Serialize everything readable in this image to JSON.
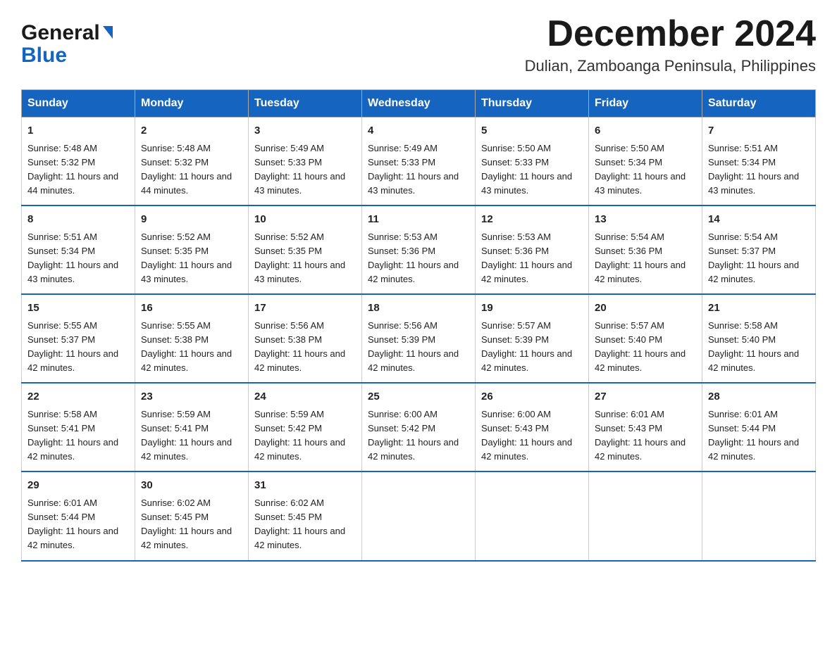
{
  "header": {
    "logo_general": "General",
    "logo_blue": "Blue",
    "month_title": "December 2024",
    "location": "Dulian, Zamboanga Peninsula, Philippines"
  },
  "days_of_week": [
    "Sunday",
    "Monday",
    "Tuesday",
    "Wednesday",
    "Thursday",
    "Friday",
    "Saturday"
  ],
  "weeks": [
    [
      {
        "day": "1",
        "sunrise": "5:48 AM",
        "sunset": "5:32 PM",
        "daylight": "11 hours and 44 minutes."
      },
      {
        "day": "2",
        "sunrise": "5:48 AM",
        "sunset": "5:32 PM",
        "daylight": "11 hours and 44 minutes."
      },
      {
        "day": "3",
        "sunrise": "5:49 AM",
        "sunset": "5:33 PM",
        "daylight": "11 hours and 43 minutes."
      },
      {
        "day": "4",
        "sunrise": "5:49 AM",
        "sunset": "5:33 PM",
        "daylight": "11 hours and 43 minutes."
      },
      {
        "day": "5",
        "sunrise": "5:50 AM",
        "sunset": "5:33 PM",
        "daylight": "11 hours and 43 minutes."
      },
      {
        "day": "6",
        "sunrise": "5:50 AM",
        "sunset": "5:34 PM",
        "daylight": "11 hours and 43 minutes."
      },
      {
        "day": "7",
        "sunrise": "5:51 AM",
        "sunset": "5:34 PM",
        "daylight": "11 hours and 43 minutes."
      }
    ],
    [
      {
        "day": "8",
        "sunrise": "5:51 AM",
        "sunset": "5:34 PM",
        "daylight": "11 hours and 43 minutes."
      },
      {
        "day": "9",
        "sunrise": "5:52 AM",
        "sunset": "5:35 PM",
        "daylight": "11 hours and 43 minutes."
      },
      {
        "day": "10",
        "sunrise": "5:52 AM",
        "sunset": "5:35 PM",
        "daylight": "11 hours and 43 minutes."
      },
      {
        "day": "11",
        "sunrise": "5:53 AM",
        "sunset": "5:36 PM",
        "daylight": "11 hours and 42 minutes."
      },
      {
        "day": "12",
        "sunrise": "5:53 AM",
        "sunset": "5:36 PM",
        "daylight": "11 hours and 42 minutes."
      },
      {
        "day": "13",
        "sunrise": "5:54 AM",
        "sunset": "5:36 PM",
        "daylight": "11 hours and 42 minutes."
      },
      {
        "day": "14",
        "sunrise": "5:54 AM",
        "sunset": "5:37 PM",
        "daylight": "11 hours and 42 minutes."
      }
    ],
    [
      {
        "day": "15",
        "sunrise": "5:55 AM",
        "sunset": "5:37 PM",
        "daylight": "11 hours and 42 minutes."
      },
      {
        "day": "16",
        "sunrise": "5:55 AM",
        "sunset": "5:38 PM",
        "daylight": "11 hours and 42 minutes."
      },
      {
        "day": "17",
        "sunrise": "5:56 AM",
        "sunset": "5:38 PM",
        "daylight": "11 hours and 42 minutes."
      },
      {
        "day": "18",
        "sunrise": "5:56 AM",
        "sunset": "5:39 PM",
        "daylight": "11 hours and 42 minutes."
      },
      {
        "day": "19",
        "sunrise": "5:57 AM",
        "sunset": "5:39 PM",
        "daylight": "11 hours and 42 minutes."
      },
      {
        "day": "20",
        "sunrise": "5:57 AM",
        "sunset": "5:40 PM",
        "daylight": "11 hours and 42 minutes."
      },
      {
        "day": "21",
        "sunrise": "5:58 AM",
        "sunset": "5:40 PM",
        "daylight": "11 hours and 42 minutes."
      }
    ],
    [
      {
        "day": "22",
        "sunrise": "5:58 AM",
        "sunset": "5:41 PM",
        "daylight": "11 hours and 42 minutes."
      },
      {
        "day": "23",
        "sunrise": "5:59 AM",
        "sunset": "5:41 PM",
        "daylight": "11 hours and 42 minutes."
      },
      {
        "day": "24",
        "sunrise": "5:59 AM",
        "sunset": "5:42 PM",
        "daylight": "11 hours and 42 minutes."
      },
      {
        "day": "25",
        "sunrise": "6:00 AM",
        "sunset": "5:42 PM",
        "daylight": "11 hours and 42 minutes."
      },
      {
        "day": "26",
        "sunrise": "6:00 AM",
        "sunset": "5:43 PM",
        "daylight": "11 hours and 42 minutes."
      },
      {
        "day": "27",
        "sunrise": "6:01 AM",
        "sunset": "5:43 PM",
        "daylight": "11 hours and 42 minutes."
      },
      {
        "day": "28",
        "sunrise": "6:01 AM",
        "sunset": "5:44 PM",
        "daylight": "11 hours and 42 minutes."
      }
    ],
    [
      {
        "day": "29",
        "sunrise": "6:01 AM",
        "sunset": "5:44 PM",
        "daylight": "11 hours and 42 minutes."
      },
      {
        "day": "30",
        "sunrise": "6:02 AM",
        "sunset": "5:45 PM",
        "daylight": "11 hours and 42 minutes."
      },
      {
        "day": "31",
        "sunrise": "6:02 AM",
        "sunset": "5:45 PM",
        "daylight": "11 hours and 42 minutes."
      },
      null,
      null,
      null,
      null
    ]
  ],
  "labels": {
    "sunrise": "Sunrise:",
    "sunset": "Sunset:",
    "daylight": "Daylight:"
  }
}
